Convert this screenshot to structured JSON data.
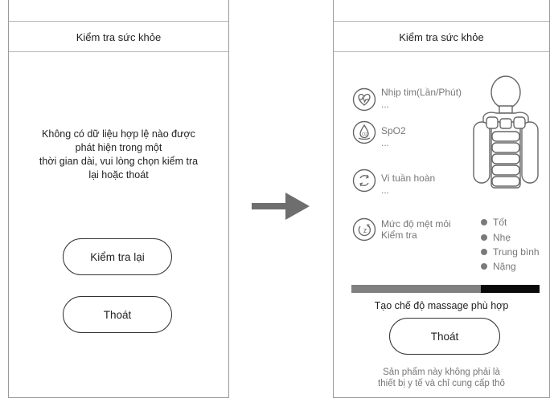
{
  "left_screen": {
    "title": "Kiểm tra sức khỏe",
    "message_lines": [
      "Không có dữ liệu hợp lệ nào được",
      "phát hiện trong một",
      "thời gian dài, vui lòng chọn kiểm tra",
      "lại hoặc thoát"
    ],
    "retry_button": "Kiểm tra lại",
    "exit_button": "Thoát"
  },
  "right_screen": {
    "title": "Kiểm tra sức khỏe",
    "metrics": [
      {
        "icon": "heart-rate-icon",
        "label": "Nhịp tim(Lần/Phút)",
        "value": "..."
      },
      {
        "icon": "spo2-drop-icon",
        "label": "SpO2",
        "value": "..."
      },
      {
        "icon": "circulation-icon",
        "label": "Vi tuần hoàn",
        "value": "..."
      },
      {
        "icon": "fatigue-icon",
        "label": "Mức độ mệt mỏi",
        "value": "Kiểm tra"
      }
    ],
    "fatigue_legend": [
      "Tốt",
      "Nhẹ",
      "Trung bình",
      "Nặng"
    ],
    "progress_light_fraction": 0.69,
    "subtitle": "Tạo chế độ massage phù hợp",
    "exit_button": "Thoát",
    "disclaimer_lines": [
      "Sản phẩm này không phải là",
      "thiết bị y tế và chỉ cung cấp thô"
    ]
  },
  "colors": {
    "border": "#9a9a9a",
    "text": "#222222",
    "muted": "#777777",
    "arrow": "#6e6e6e",
    "bar_light": "#808080",
    "bar_dark": "#0a0a0a"
  }
}
